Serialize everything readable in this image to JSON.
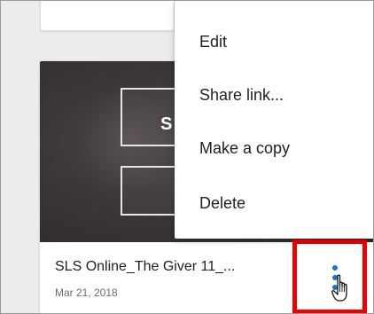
{
  "file_card": {
    "title": "SLS Online_The Giver 11_...",
    "date": "Mar 21, 2018",
    "thumbnail_text": "S"
  },
  "context_menu": {
    "items": [
      {
        "label": "Edit"
      },
      {
        "label": "Share link..."
      },
      {
        "label": "Make a copy"
      },
      {
        "label": "Delete"
      }
    ]
  },
  "icons": {
    "more": "more-vert-icon",
    "cursor": "hand-pointer-icon"
  },
  "colors": {
    "highlight": "#ee0000",
    "more_dots": "#1a73c9",
    "thumbnail_bg": "#3a3437"
  }
}
